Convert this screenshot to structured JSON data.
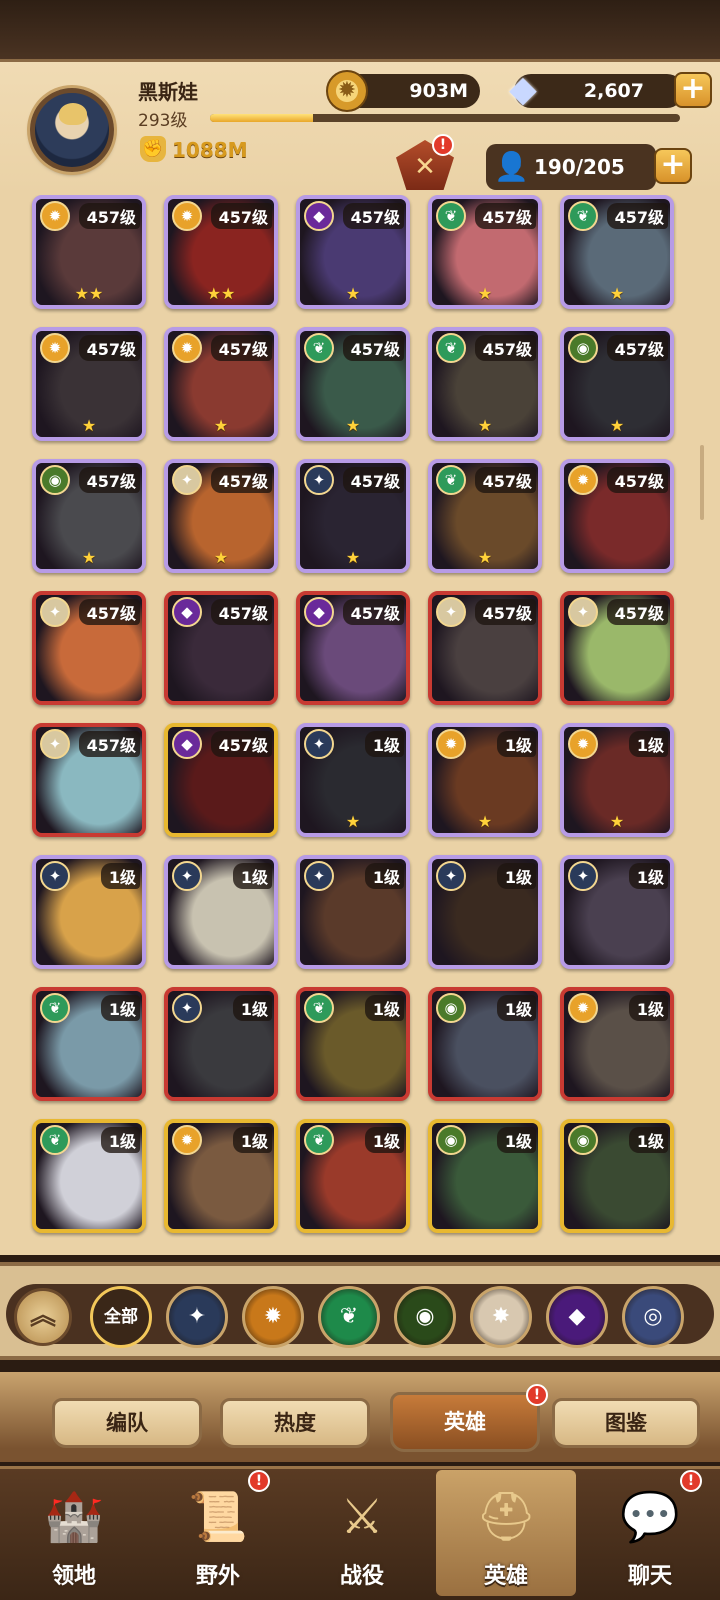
{
  "player": {
    "name": "黑斯娃",
    "level": "293级",
    "xp_fraction": 0.22,
    "power": "1088M"
  },
  "resources": {
    "gold": "903M",
    "gems": "2,607",
    "roster": "190/205"
  },
  "icons": {
    "gold": "coin-icon",
    "gem": "diamond-icon",
    "roster": "person-icon",
    "power": "fist-icon",
    "resonance": "resonance-crystal-icon"
  },
  "heroes": [
    {
      "level": "457级",
      "stars": "★★",
      "frame": "purple",
      "faction": "lightbearer",
      "portrait": "#5a3a3a"
    },
    {
      "level": "457级",
      "stars": "★★",
      "frame": "purple",
      "faction": "lightbearer",
      "portrait": "#8a2420"
    },
    {
      "level": "457级",
      "stars": "★",
      "frame": "purple",
      "faction": "hypogean",
      "portrait": "#4a3a72"
    },
    {
      "level": "457级",
      "stars": "★",
      "frame": "purple",
      "faction": "wilder",
      "portrait": "#c26a70"
    },
    {
      "level": "457级",
      "stars": "★",
      "frame": "purple",
      "faction": "wilder",
      "portrait": "#5a6a78"
    },
    {
      "level": "457级",
      "stars": "★",
      "frame": "purple",
      "faction": "lightbearer",
      "portrait": "#3a3236"
    },
    {
      "level": "457级",
      "stars": "★",
      "frame": "purple",
      "faction": "lightbearer",
      "portrait": "#8a3a30"
    },
    {
      "level": "457级",
      "stars": "★",
      "frame": "purple",
      "faction": "wilder",
      "portrait": "#3a5a4a"
    },
    {
      "level": "457级",
      "stars": "★",
      "frame": "purple",
      "faction": "wilder",
      "portrait": "#4a4238"
    },
    {
      "level": "457级",
      "stars": "★",
      "frame": "purple",
      "faction": "graveborn",
      "portrait": "#2e2e34"
    },
    {
      "level": "457级",
      "stars": "★",
      "frame": "purple",
      "faction": "graveborn",
      "portrait": "#4a4a4e"
    },
    {
      "level": "457级",
      "stars": "★",
      "frame": "purple",
      "faction": "celestial",
      "portrait": "#b8642e"
    },
    {
      "level": "457级",
      "stars": "★",
      "frame": "purple",
      "faction": "dimensional",
      "portrait": "#2a2432"
    },
    {
      "level": "457级",
      "stars": "★",
      "frame": "purple",
      "faction": "wilder",
      "portrait": "#6a4a2a"
    },
    {
      "level": "457级",
      "stars": "",
      "frame": "purple",
      "faction": "lightbearer",
      "portrait": "#7a2a2a"
    },
    {
      "level": "457级",
      "stars": "",
      "frame": "red",
      "faction": "celestial",
      "portrait": "#c86a3a"
    },
    {
      "level": "457级",
      "stars": "",
      "frame": "red",
      "faction": "hypogean",
      "portrait": "#3a2a3a"
    },
    {
      "level": "457级",
      "stars": "",
      "frame": "red",
      "faction": "hypogean",
      "portrait": "#6a4a7a"
    },
    {
      "level": "457级",
      "stars": "",
      "frame": "red",
      "faction": "celestial",
      "portrait": "#4a4040"
    },
    {
      "level": "457级",
      "stars": "",
      "frame": "red",
      "faction": "celestial",
      "portrait": "#9ab86a"
    },
    {
      "level": "457级",
      "stars": "",
      "frame": "red",
      "faction": "celestial",
      "portrait": "#8ab8c0"
    },
    {
      "level": "457级",
      "stars": "",
      "frame": "gold",
      "faction": "hypogean",
      "portrait": "#5a1a1a"
    },
    {
      "level": "1级",
      "stars": "★",
      "frame": "purple",
      "faction": "dimensional",
      "portrait": "#2a2a30"
    },
    {
      "level": "1级",
      "stars": "★",
      "frame": "purple",
      "faction": "lightbearer",
      "portrait": "#6a3a22"
    },
    {
      "level": "1级",
      "stars": "★",
      "frame": "purple",
      "faction": "lightbearer",
      "portrait": "#6a2a26"
    },
    {
      "level": "1级",
      "stars": "",
      "frame": "purple",
      "faction": "dimensional",
      "portrait": "#d8a24a"
    },
    {
      "level": "1级",
      "stars": "",
      "frame": "purple",
      "faction": "dimensional",
      "portrait": "#c8c2b0"
    },
    {
      "level": "1级",
      "stars": "",
      "frame": "purple",
      "faction": "dimensional",
      "portrait": "#5a3a2a"
    },
    {
      "level": "1级",
      "stars": "",
      "frame": "purple",
      "faction": "dimensional",
      "portrait": "#3a2a20"
    },
    {
      "level": "1级",
      "stars": "",
      "frame": "purple",
      "faction": "dimensional",
      "portrait": "#4a4050"
    },
    {
      "level": "1级",
      "stars": "",
      "frame": "red",
      "faction": "wilder",
      "portrait": "#7a9aa8"
    },
    {
      "level": "1级",
      "stars": "",
      "frame": "red",
      "faction": "dimensional",
      "portrait": "#3a3a3e"
    },
    {
      "level": "1级",
      "stars": "",
      "frame": "red",
      "faction": "wilder",
      "portrait": "#6a5a2a"
    },
    {
      "level": "1级",
      "stars": "",
      "frame": "red",
      "faction": "graveborn",
      "portrait": "#4a5060"
    },
    {
      "level": "1级",
      "stars": "",
      "frame": "red",
      "faction": "lightbearer",
      "portrait": "#5a5048"
    },
    {
      "level": "1级",
      "stars": "",
      "frame": "gold",
      "faction": "wilder",
      "portrait": "#d0d0d8"
    },
    {
      "level": "1级",
      "stars": "",
      "frame": "gold",
      "faction": "lightbearer",
      "portrait": "#7a5a40"
    },
    {
      "level": "1级",
      "stars": "",
      "frame": "gold",
      "faction": "wilder",
      "portrait": "#9a3a2a"
    },
    {
      "level": "1级",
      "stars": "",
      "frame": "gold",
      "faction": "graveborn",
      "portrait": "#3a5a3a"
    },
    {
      "level": "1级",
      "stars": "",
      "frame": "gold",
      "faction": "graveborn",
      "portrait": "#3a4a32"
    }
  ],
  "factions": {
    "lightbearer": {
      "color": "#e8a22a",
      "glyph": "✹",
      "icon": "lightbearer-icon"
    },
    "wilder": {
      "color": "#2e9a5a",
      "glyph": "❦",
      "icon": "wilder-icon"
    },
    "graveborn": {
      "color": "#4a7a2a",
      "glyph": "◉",
      "icon": "graveborn-icon"
    },
    "hypogean": {
      "color": "#6a2a9a",
      "glyph": "◆",
      "icon": "hypogean-icon"
    },
    "celestial": {
      "color": "#d8c8a0",
      "glyph": "✦",
      "icon": "celestial-icon"
    },
    "dimensional": {
      "color": "#2a3a5a",
      "glyph": "✦",
      "icon": "dimensional-icon"
    }
  },
  "filters": {
    "all_label": "全部",
    "items": [
      {
        "icon": "dimensional-filter-icon",
        "glyph": "✦",
        "color": "#2a3a5a"
      },
      {
        "icon": "lightbearer-filter-icon",
        "glyph": "✹",
        "color": "#c8781a"
      },
      {
        "icon": "wilder-filter-icon",
        "glyph": "❦",
        "color": "#1e8a4a"
      },
      {
        "icon": "graveborn-filter-icon",
        "glyph": "◉",
        "color": "#2a4a1a"
      },
      {
        "icon": "celestial-filter-icon",
        "glyph": "✸",
        "color": "#d8c8b0"
      },
      {
        "icon": "hypogean-filter-icon",
        "glyph": "◆",
        "color": "#4a1a7a"
      },
      {
        "icon": "mauler-filter-icon",
        "glyph": "◎",
        "color": "#3a4a7a"
      }
    ]
  },
  "tabs": [
    {
      "label": "编队",
      "active": false
    },
    {
      "label": "热度",
      "active": false
    },
    {
      "label": "英雄",
      "active": true,
      "badge": "!"
    },
    {
      "label": "图鉴",
      "active": false
    }
  ],
  "nav": [
    {
      "label": "领地",
      "icon": "castle-icon",
      "glyph": "🏰",
      "active": false,
      "badge": ""
    },
    {
      "label": "野外",
      "icon": "scroll-map-icon",
      "glyph": "📜",
      "active": false,
      "badge": "!"
    },
    {
      "label": "战役",
      "icon": "battle-crest-icon",
      "glyph": "⚔",
      "active": false,
      "badge": ""
    },
    {
      "label": "英雄",
      "icon": "helmet-icon",
      "glyph": "⛑",
      "active": true,
      "badge": ""
    },
    {
      "label": "聊天",
      "icon": "chat-bubble-icon",
      "glyph": "💬",
      "active": false,
      "badge": "!"
    }
  ],
  "badges": {
    "resonance": "!"
  }
}
